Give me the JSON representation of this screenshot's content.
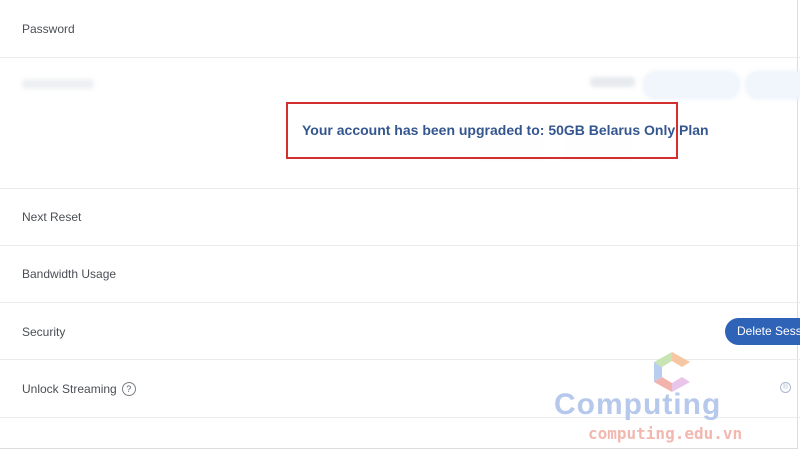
{
  "rows": {
    "password": "Password",
    "next_reset": "Next Reset",
    "bandwidth_usage": "Bandwidth Usage",
    "security": "Security",
    "unlock_streaming": "Unlock Streaming"
  },
  "notice": {
    "message": "Your account has been upgraded to: 50GB Belarus Only Plan",
    "border_color": "#d32f2f",
    "text_color": "#34568f"
  },
  "actions": {
    "delete_sessions_label": "Delete Sessions"
  },
  "icons": {
    "help": "?"
  },
  "watermark": {
    "word": "Computing",
    "domain": "computing.edu.vn",
    "registered": "®"
  },
  "colors": {
    "accent": "#2e63b8"
  }
}
